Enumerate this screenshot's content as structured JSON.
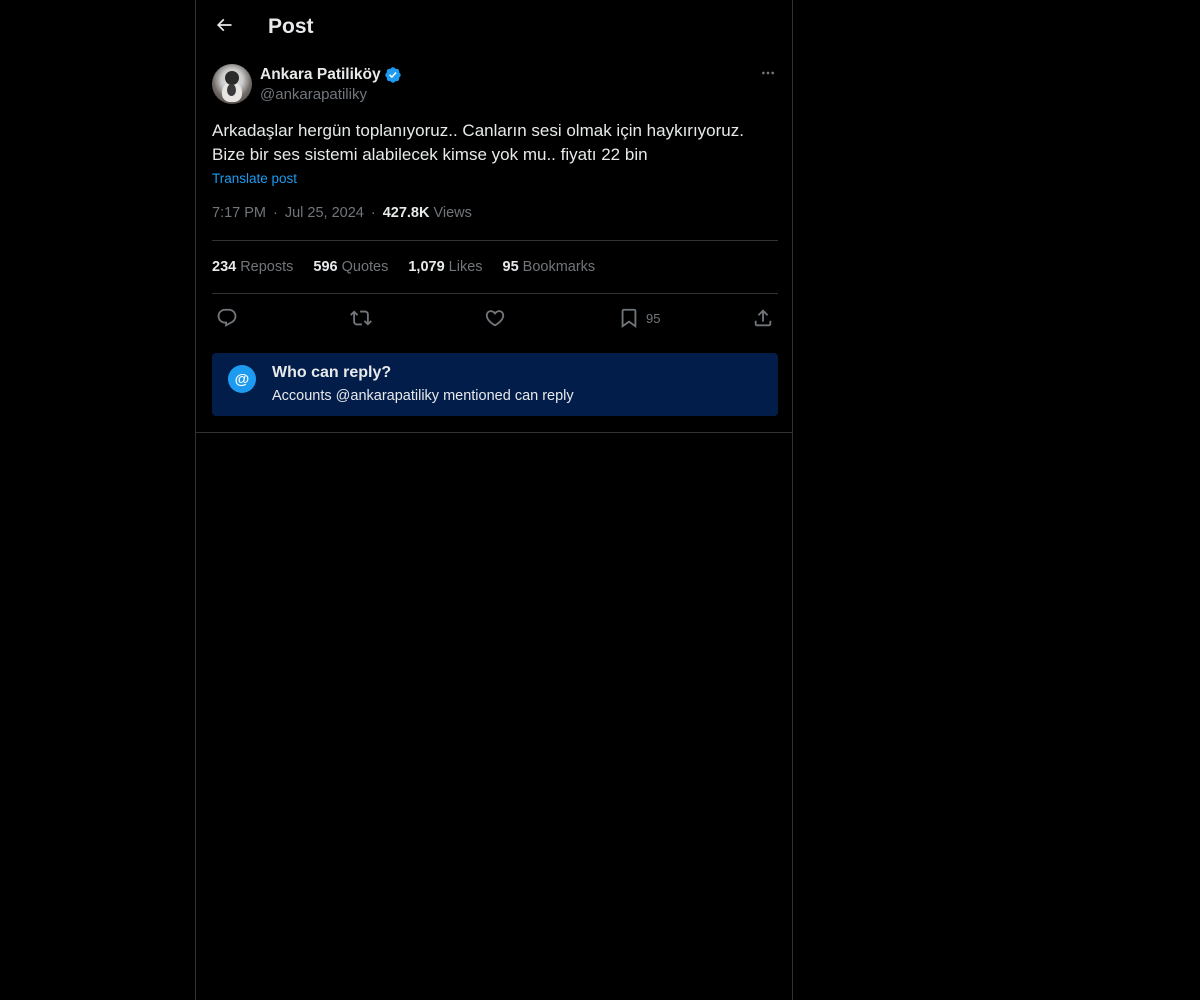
{
  "header": {
    "title": "Post",
    "back_icon": "arrow-left-icon"
  },
  "post": {
    "author": {
      "name": "Ankara Patiliköy",
      "handle": "@ankarapatiliky",
      "verified": true,
      "avatar_icon": "dog-avatar"
    },
    "text": "Arkadaşlar hergün toplanıyoruz.. Canların sesi olmak için haykırıyoruz.\nBize bir ses sistemi alabilecek kimse yok mu.. fiyatı 22 bin",
    "translate_label": "Translate post",
    "time": "7:17 PM",
    "date": "Jul 25, 2024",
    "separator": "·",
    "views_count": "427.8K",
    "views_label": "Views"
  },
  "stats": {
    "reposts_count": "234",
    "reposts_label": "Reposts",
    "quotes_count": "596",
    "quotes_label": "Quotes",
    "likes_count": "1,079",
    "likes_label": "Likes",
    "bookmarks_count": "95",
    "bookmarks_label": "Bookmarks"
  },
  "actions": {
    "reply_icon": "reply-icon",
    "repost_icon": "repost-icon",
    "like_icon": "heart-icon",
    "bookmark_icon": "bookmark-icon",
    "bookmark_count": "95",
    "share_icon": "share-icon"
  },
  "reply_restriction": {
    "icon_glyph": "@",
    "title": "Who can reply?",
    "subtitle": "Accounts @ankarapatiliky mentioned can reply"
  },
  "colors": {
    "background": "#000000",
    "text_primary": "#e7e9ea",
    "text_secondary": "#71767b",
    "accent": "#1d9bf0",
    "border": "#2f3336",
    "reply_box_bg": "#031d4a"
  }
}
